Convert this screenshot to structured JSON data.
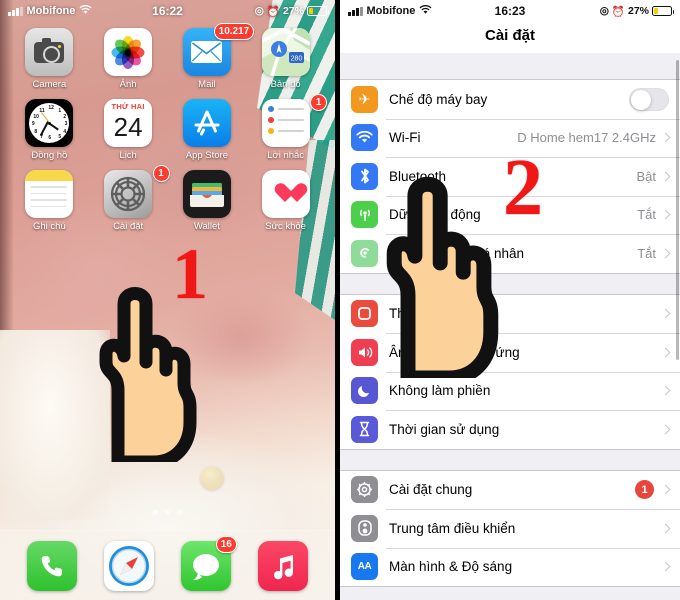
{
  "left_screen": {
    "status_bar": {
      "carrier": "Mobifone",
      "time": "16:22",
      "battery": "27%"
    },
    "apps": [
      {
        "label": "Camera",
        "icon": "camera-icon",
        "badge": null
      },
      {
        "label": "Ảnh",
        "icon": "photos-icon",
        "badge": null
      },
      {
        "label": "Mail",
        "icon": "mail-icon",
        "badge": "10.217"
      },
      {
        "label": "Bản đồ",
        "icon": "maps-icon",
        "badge": null
      },
      {
        "label": "Đồng hồ",
        "icon": "clock-icon",
        "badge": null
      },
      {
        "label": "Lịch",
        "icon": "calendar-icon",
        "badge": null,
        "cal_weekday": "THỨ HAI",
        "cal_day": "24"
      },
      {
        "label": "App Store",
        "icon": "appstore-icon",
        "badge": null
      },
      {
        "label": "Lời nhắc",
        "icon": "reminders-icon",
        "badge": "1"
      },
      {
        "label": "Ghi chú",
        "icon": "notes-icon",
        "badge": null
      },
      {
        "label": "Cài đặt",
        "icon": "settings-gear-icon",
        "badge": "1"
      },
      {
        "label": "Wallet",
        "icon": "wallet-icon",
        "badge": null
      },
      {
        "label": "Sức khỏe",
        "icon": "health-heart-icon",
        "badge": null
      }
    ],
    "dock": [
      {
        "label": "Phone",
        "icon": "phone-icon",
        "badge": null
      },
      {
        "label": "Safari",
        "icon": "safari-compass-icon",
        "badge": null
      },
      {
        "label": "Messages",
        "icon": "messages-icon",
        "badge": "16"
      },
      {
        "label": "Music",
        "icon": "music-note-icon",
        "badge": null
      }
    ],
    "page_dots": {
      "count": 3,
      "active": 0
    },
    "step_marker": "1"
  },
  "right_screen": {
    "status_bar": {
      "carrier": "Mobifone",
      "time": "16:23",
      "battery": "27%"
    },
    "title": "Cài đặt",
    "step_marker": "2",
    "groups": [
      {
        "rows": [
          {
            "label": "Chế độ máy bay",
            "icon": "airplane-icon",
            "control": "toggle",
            "toggle_on": false
          },
          {
            "label": "Wi-Fi",
            "icon": "wifi-icon",
            "value": "D Home hem17 2.4GHz",
            "control": "chevron"
          },
          {
            "label": "Bluetooth",
            "icon": "bluetooth-icon",
            "value": "Bật",
            "control": "chevron"
          },
          {
            "label": "Dữ liệu di động",
            "icon": "cellular-icon",
            "value": "Tắt",
            "control": "chevron"
          },
          {
            "label": "Điểm truy cập cá nhân",
            "icon": "hotspot-icon",
            "value": "Tắt",
            "control": "chevron"
          }
        ]
      },
      {
        "rows": [
          {
            "label": "Thông báo",
            "icon": "notifications-icon",
            "value": "",
            "control": "chevron"
          },
          {
            "label": "Âm thanh & Cảm ứng",
            "icon": "sound-icon",
            "value": "",
            "control": "chevron"
          },
          {
            "label": "Không làm phiền",
            "icon": "do-not-disturb-icon",
            "value": "",
            "control": "chevron"
          },
          {
            "label": "Thời gian sử dụng",
            "icon": "screen-time-icon",
            "value": "",
            "control": "chevron"
          }
        ]
      },
      {
        "rows": [
          {
            "label": "Cài đặt chung",
            "icon": "general-gear-icon",
            "badge": "1",
            "control": "chevron"
          },
          {
            "label": "Trung tâm điều khiển",
            "icon": "control-center-icon",
            "value": "",
            "control": "chevron"
          },
          {
            "label": "Màn hình & Độ sáng",
            "icon": "display-brightness-icon",
            "value": "",
            "control": "chevron",
            "icon_text": "AA"
          }
        ]
      }
    ]
  },
  "colors": {
    "marker_red": "#f01717",
    "badge_red": "#ff3b30",
    "accent_blue": "#3478f6",
    "skin": "#fcd29a"
  }
}
